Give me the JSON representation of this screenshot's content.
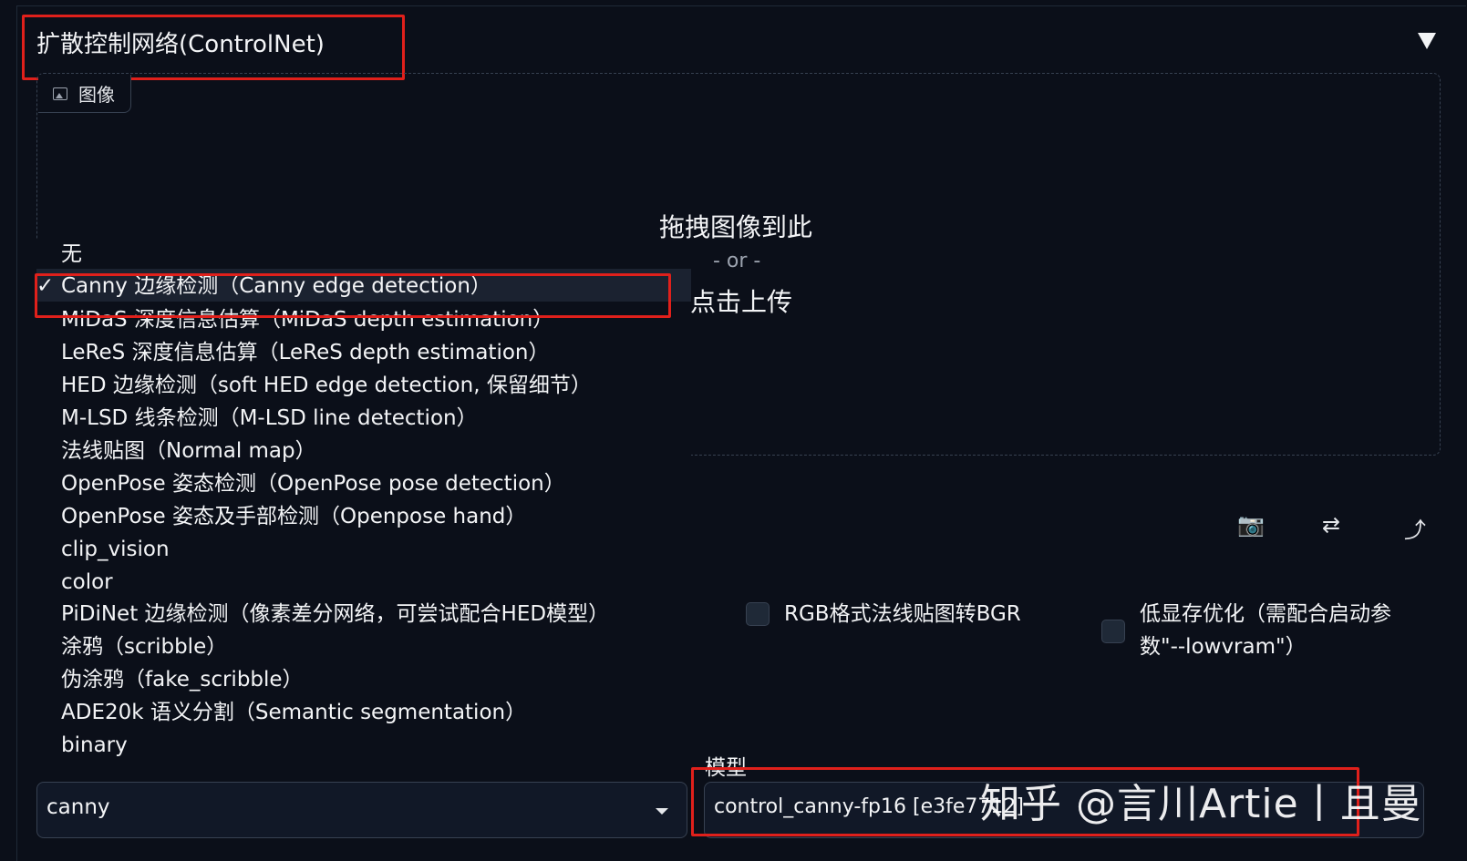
{
  "accordion": {
    "title": "扩散控制网络(ControlNet)"
  },
  "image_panel": {
    "tab_label": "图像",
    "drop_text": "拖拽图像到此",
    "or_text": "- or -",
    "upload_text": "点击上传"
  },
  "preprocessor_dropdown": {
    "check_mark": "✓",
    "options": [
      "无",
      "Canny 边缘检测（Canny edge detection）",
      "MiDaS 深度信息估算（MiDaS depth estimation）",
      "LeReS 深度信息估算（LeReS depth estimation）",
      "HED 边缘检测（soft HED edge detection, 保留细节）",
      "M-LSD 线条检测（M-LSD line detection）",
      "法线贴图（Normal map）",
      "OpenPose 姿态检测（OpenPose pose detection）",
      "OpenPose 姿态及手部检测（Openpose hand）",
      "clip_vision",
      "color",
      "PiDiNet 边缘检测（像素差分网络，可尝试配合HED模型）",
      "涂鸦（scribble）",
      "伪涂鸦（fake_scribble）",
      "ADE20k 语义分割（Semantic segmentation）",
      "binary"
    ],
    "selected_index": 1,
    "selected_value": "canny"
  },
  "toolbar_icons": [
    "camera-icon",
    "swap-icon",
    "arrow-up-right-icon"
  ],
  "toolbar_glyphs": {
    "camera": "📷",
    "swap": "⇄",
    "send": "⤴"
  },
  "checkboxes": {
    "rgb_to_bgr": {
      "label": "RGB格式法线贴图转BGR",
      "checked": false
    },
    "low_vram": {
      "label_line1": "低显存优化（需配合启动参",
      "label_line2": "数\"--lowvram\"）",
      "checked": false
    }
  },
  "model": {
    "label": "模型",
    "value": "control_canny-fp16 [e3fe7712]"
  },
  "watermark": "知乎 @言川Artie丨且曼",
  "colors": {
    "background": "#0b0f19",
    "highlight": "#e0201b"
  }
}
